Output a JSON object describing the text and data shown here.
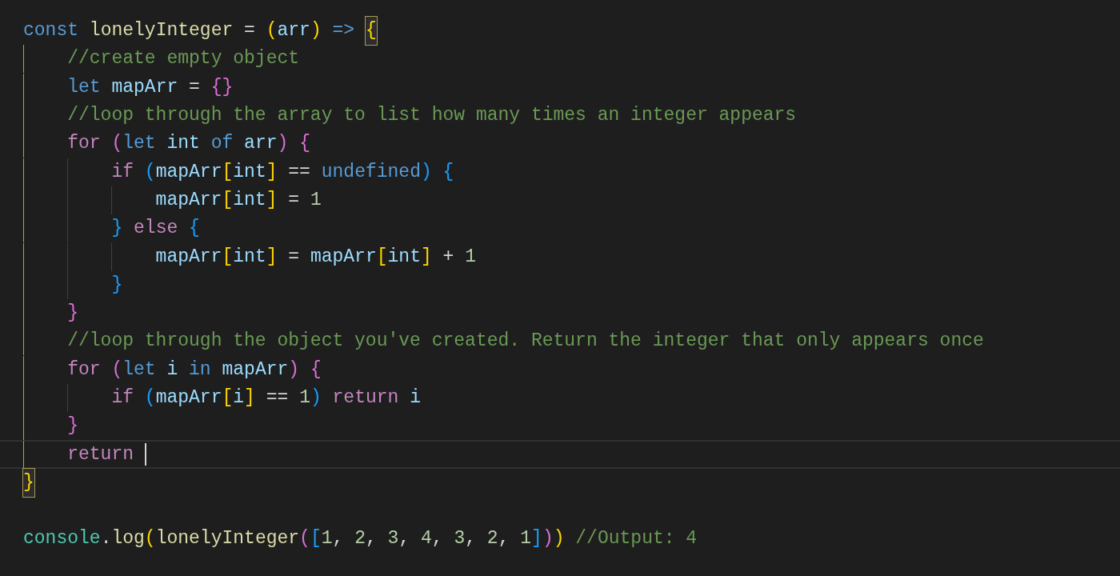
{
  "lines": [
    {
      "tokens": [
        {
          "text": "const ",
          "kind": "keyword"
        },
        {
          "text": "lonelyInteger",
          "kind": "function"
        },
        {
          "text": " = "
        },
        {
          "text": "(",
          "kind": "bracket",
          "color": "#ffd700"
        },
        {
          "text": "arr",
          "kind": "variable"
        },
        {
          "text": ")",
          "kind": "bracket",
          "color": "#ffd700"
        },
        {
          "text": " => ",
          "kind": "keyword"
        },
        {
          "text": "{",
          "kind": "bracket",
          "color": "#ffd700",
          "matched": true
        }
      ]
    },
    {
      "tokens": [
        {
          "text": "    //create empty object",
          "kind": "comment"
        }
      ]
    },
    {
      "tokens": [
        {
          "text": "    let ",
          "kind": "keyword"
        },
        {
          "text": "mapArr",
          "kind": "variable"
        },
        {
          "text": " = "
        },
        {
          "text": "{}",
          "kind": "bracket",
          "color": "#da70d6"
        }
      ]
    },
    {
      "tokens": [
        {
          "text": "    //loop through the array to list how many times an integer appears",
          "kind": "comment"
        }
      ]
    },
    {
      "tokens": [
        {
          "text": "    for ",
          "kind": "control"
        },
        {
          "text": "(",
          "kind": "bracket",
          "color": "#da70d6"
        },
        {
          "text": "let ",
          "kind": "keyword"
        },
        {
          "text": "int ",
          "kind": "variable"
        },
        {
          "text": "of ",
          "kind": "keyword"
        },
        {
          "text": "arr",
          "kind": "variable"
        },
        {
          "text": ")",
          "kind": "bracket",
          "color": "#da70d6"
        },
        {
          "text": " {",
          "kind": "bracket",
          "color": "#da70d6"
        }
      ]
    },
    {
      "tokens": [
        {
          "text": "        if ",
          "kind": "control"
        },
        {
          "text": "(",
          "kind": "bracket",
          "color": "#179fff"
        },
        {
          "text": "mapArr",
          "kind": "variable"
        },
        {
          "text": "[",
          "kind": "bracket",
          "color": "#ffd700"
        },
        {
          "text": "int",
          "kind": "variable"
        },
        {
          "text": "]",
          "kind": "bracket",
          "color": "#ffd700"
        },
        {
          "text": " == "
        },
        {
          "text": "undefined",
          "kind": "keyword"
        },
        {
          "text": ")",
          "kind": "bracket",
          "color": "#179fff"
        },
        {
          "text": " {",
          "kind": "bracket",
          "color": "#179fff"
        }
      ]
    },
    {
      "tokens": [
        {
          "text": "            mapArr",
          "kind": "variable"
        },
        {
          "text": "[",
          "kind": "bracket",
          "color": "#ffd700"
        },
        {
          "text": "int",
          "kind": "variable"
        },
        {
          "text": "]",
          "kind": "bracket",
          "color": "#ffd700"
        },
        {
          "text": " = "
        },
        {
          "text": "1",
          "kind": "number"
        }
      ]
    },
    {
      "tokens": [
        {
          "text": "        }",
          "kind": "bracket",
          "color": "#179fff"
        },
        {
          "text": " else ",
          "kind": "control"
        },
        {
          "text": "{",
          "kind": "bracket",
          "color": "#179fff"
        }
      ]
    },
    {
      "tokens": [
        {
          "text": "            mapArr",
          "kind": "variable"
        },
        {
          "text": "[",
          "kind": "bracket",
          "color": "#ffd700"
        },
        {
          "text": "int",
          "kind": "variable"
        },
        {
          "text": "]",
          "kind": "bracket",
          "color": "#ffd700"
        },
        {
          "text": " = "
        },
        {
          "text": "mapArr",
          "kind": "variable"
        },
        {
          "text": "[",
          "kind": "bracket",
          "color": "#ffd700"
        },
        {
          "text": "int",
          "kind": "variable"
        },
        {
          "text": "]",
          "kind": "bracket",
          "color": "#ffd700"
        },
        {
          "text": " + "
        },
        {
          "text": "1",
          "kind": "number"
        }
      ]
    },
    {
      "tokens": [
        {
          "text": "        }",
          "kind": "bracket",
          "color": "#179fff"
        }
      ]
    },
    {
      "tokens": [
        {
          "text": "    }",
          "kind": "bracket",
          "color": "#da70d6"
        }
      ]
    },
    {
      "tokens": [
        {
          "text": "    //loop through the object you've created. Return the integer that only appears once",
          "kind": "comment"
        }
      ]
    },
    {
      "tokens": [
        {
          "text": "    for ",
          "kind": "control"
        },
        {
          "text": "(",
          "kind": "bracket",
          "color": "#da70d6"
        },
        {
          "text": "let ",
          "kind": "keyword"
        },
        {
          "text": "i ",
          "kind": "variable"
        },
        {
          "text": "in ",
          "kind": "keyword"
        },
        {
          "text": "mapArr",
          "kind": "variable"
        },
        {
          "text": ")",
          "kind": "bracket",
          "color": "#da70d6"
        },
        {
          "text": " {",
          "kind": "bracket",
          "color": "#da70d6"
        }
      ]
    },
    {
      "tokens": [
        {
          "text": "        if ",
          "kind": "control"
        },
        {
          "text": "(",
          "kind": "bracket",
          "color": "#179fff"
        },
        {
          "text": "mapArr",
          "kind": "variable"
        },
        {
          "text": "[",
          "kind": "bracket",
          "color": "#ffd700"
        },
        {
          "text": "i",
          "kind": "variable"
        },
        {
          "text": "]",
          "kind": "bracket",
          "color": "#ffd700"
        },
        {
          "text": " == "
        },
        {
          "text": "1",
          "kind": "number"
        },
        {
          "text": ")",
          "kind": "bracket",
          "color": "#179fff"
        },
        {
          "text": " return ",
          "kind": "control"
        },
        {
          "text": "i",
          "kind": "variable"
        }
      ]
    },
    {
      "tokens": [
        {
          "text": "    }",
          "kind": "bracket",
          "color": "#da70d6"
        }
      ]
    },
    {
      "current": true,
      "cursor": true,
      "tokens": [
        {
          "text": "    return ",
          "kind": "control"
        }
      ]
    },
    {
      "tokens": [
        {
          "text": "}",
          "kind": "bracket",
          "color": "#ffd700",
          "matched": true
        }
      ]
    },
    {
      "tokens": [
        {
          "text": "console",
          "kind": "class"
        },
        {
          "text": "."
        },
        {
          "text": "log",
          "kind": "function"
        },
        {
          "text": "(",
          "kind": "bracket",
          "color": "#ffd700"
        },
        {
          "text": "lonelyInteger",
          "kind": "function"
        },
        {
          "text": "(",
          "kind": "bracket",
          "color": "#da70d6"
        },
        {
          "text": "[",
          "kind": "bracket",
          "color": "#179fff"
        },
        {
          "text": "1",
          "kind": "number"
        },
        {
          "text": ", "
        },
        {
          "text": "2",
          "kind": "number"
        },
        {
          "text": ", "
        },
        {
          "text": "3",
          "kind": "number"
        },
        {
          "text": ", "
        },
        {
          "text": "4",
          "kind": "number"
        },
        {
          "text": ", "
        },
        {
          "text": "3",
          "kind": "number"
        },
        {
          "text": ", "
        },
        {
          "text": "2",
          "kind": "number"
        },
        {
          "text": ", "
        },
        {
          "text": "1",
          "kind": "number"
        },
        {
          "text": "]",
          "kind": "bracket",
          "color": "#179fff"
        },
        {
          "text": ")",
          "kind": "bracket",
          "color": "#da70d6"
        },
        {
          "text": ")",
          "kind": "bracket",
          "color": "#ffd700"
        },
        {
          "text": " //Output: 4",
          "kind": "comment"
        }
      ]
    }
  ]
}
